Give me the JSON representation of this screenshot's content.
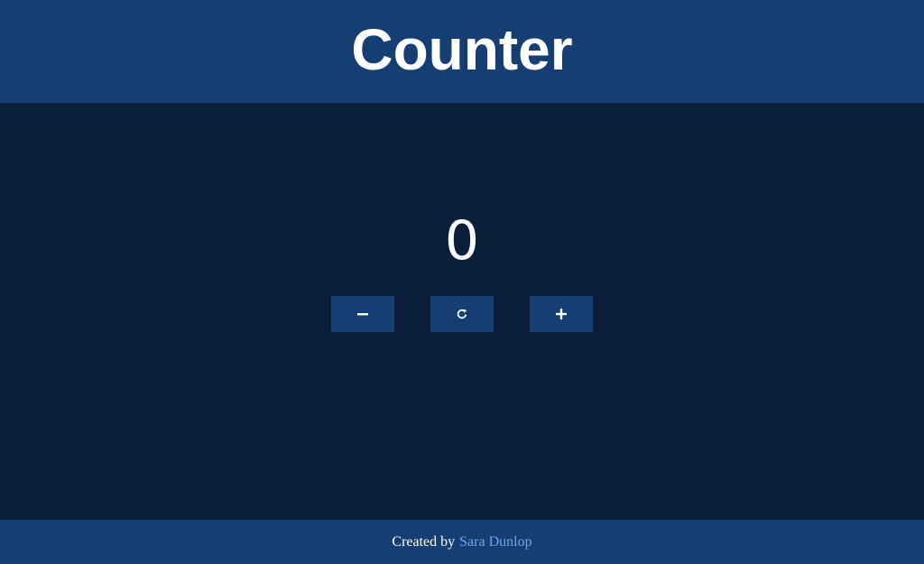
{
  "header": {
    "title": "Counter"
  },
  "counter": {
    "value": "0"
  },
  "controls": {
    "decrement_icon": "minus-icon",
    "reset_icon": "reset-icon",
    "increment_icon": "plus-icon"
  },
  "footer": {
    "prefix": "Created by",
    "author_link": "Sara Dunlop"
  },
  "colors": {
    "background": "#0b1f3a",
    "bar": "#153e73",
    "link": "#6aa6ee",
    "text": "#ffffff"
  }
}
